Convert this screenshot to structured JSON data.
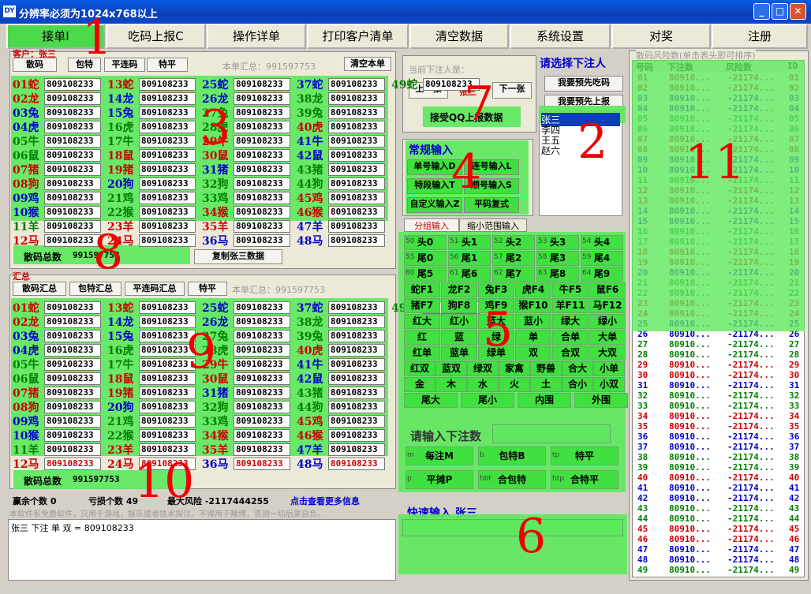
{
  "window": {
    "title": "分辨率必须为1024x768以上",
    "icon": "DY"
  },
  "menu": [
    "接单I",
    "吃码上报C",
    "操作详单",
    "打印客户清单",
    "清空数据",
    "系统设置",
    "对奖",
    "注册"
  ],
  "client": {
    "label": "客户：张三",
    "btns": [
      "散码",
      "包特",
      "平连码",
      "特平"
    ],
    "summary": "本单汇总：991597753",
    "clear": "清空本单",
    "total_label": "散码总数",
    "total_value": "991597753",
    "copy": "复制张三数据"
  },
  "cells": [
    {
      "n": "01",
      "a": "蛇",
      "v": "809108233"
    },
    {
      "n": "02",
      "a": "龙",
      "v": "809108233"
    },
    {
      "n": "03",
      "a": "兔",
      "v": "809108233"
    },
    {
      "n": "04",
      "a": "虎",
      "v": "809108233"
    },
    {
      "n": "05",
      "a": "牛",
      "v": "809108233"
    },
    {
      "n": "06",
      "a": "鼠",
      "v": "809108233"
    },
    {
      "n": "07",
      "a": "猪",
      "v": "809108233"
    },
    {
      "n": "08",
      "a": "狗",
      "v": "809108233"
    },
    {
      "n": "09",
      "a": "鸡",
      "v": "809108233"
    },
    {
      "n": "10",
      "a": "猴",
      "v": "809108233"
    },
    {
      "n": "11",
      "a": "羊",
      "v": "809108233"
    },
    {
      "n": "12",
      "a": "马",
      "v": "809108233"
    },
    {
      "n": "13",
      "a": "蛇",
      "v": "809108233"
    },
    {
      "n": "14",
      "a": "龙",
      "v": "809108233"
    },
    {
      "n": "15",
      "a": "兔",
      "v": "809108233"
    },
    {
      "n": "16",
      "a": "虎",
      "v": "809108233"
    },
    {
      "n": "17",
      "a": "牛",
      "v": "809108233"
    },
    {
      "n": "18",
      "a": "鼠",
      "v": "809108233"
    },
    {
      "n": "19",
      "a": "猪",
      "v": "809108233"
    },
    {
      "n": "20",
      "a": "狗",
      "v": "809108233"
    },
    {
      "n": "21",
      "a": "鸡",
      "v": "809108233"
    },
    {
      "n": "22",
      "a": "猴",
      "v": "809108233"
    },
    {
      "n": "23",
      "a": "羊",
      "v": "809108233"
    },
    {
      "n": "24",
      "a": "马",
      "v": "809108233"
    },
    {
      "n": "25",
      "a": "蛇",
      "v": "809108233"
    },
    {
      "n": "26",
      "a": "龙",
      "v": "809108233"
    },
    {
      "n": "27",
      "a": "兔",
      "v": "809108233"
    },
    {
      "n": "28",
      "a": "虎",
      "v": "809108233"
    },
    {
      "n": "29",
      "a": "牛",
      "v": "809108233"
    },
    {
      "n": "30",
      "a": "鼠",
      "v": "809108233"
    },
    {
      "n": "31",
      "a": "猪",
      "v": "809108233"
    },
    {
      "n": "32",
      "a": "狗",
      "v": "809108233"
    },
    {
      "n": "33",
      "a": "鸡",
      "v": "809108233"
    },
    {
      "n": "34",
      "a": "猴",
      "v": "809108233"
    },
    {
      "n": "35",
      "a": "羊",
      "v": "809108233"
    },
    {
      "n": "36",
      "a": "马",
      "v": "809108233"
    },
    {
      "n": "37",
      "a": "蛇",
      "v": "809108233"
    },
    {
      "n": "38",
      "a": "龙",
      "v": "809108233"
    },
    {
      "n": "39",
      "a": "兔",
      "v": "809108233"
    },
    {
      "n": "40",
      "a": "虎",
      "v": "809108233"
    },
    {
      "n": "41",
      "a": "牛",
      "v": "809108233"
    },
    {
      "n": "42",
      "a": "鼠",
      "v": "809108233"
    },
    {
      "n": "43",
      "a": "猪",
      "v": "809108233"
    },
    {
      "n": "44",
      "a": "狗",
      "v": "809108233"
    },
    {
      "n": "45",
      "a": "鸡",
      "v": "809108233"
    },
    {
      "n": "46",
      "a": "猴",
      "v": "809108233"
    },
    {
      "n": "47",
      "a": "羊",
      "v": "809108233"
    },
    {
      "n": "48",
      "a": "马",
      "v": "809108233"
    },
    {
      "n": "49",
      "a": "蛇",
      "v": "809108233"
    }
  ],
  "summary_panel": {
    "label": "汇总",
    "btns": [
      "散码汇总",
      "包特汇总",
      "平连码汇总",
      "特平"
    ],
    "summary": "本单汇总：991597753",
    "total_label": "散码总数",
    "total_value": "991597753"
  },
  "status": {
    "win": "赢余个数 0",
    "loss": "亏损个数 49",
    "risk": "最大风险 -2117444255",
    "more": "点击查看更多信息"
  },
  "notice": "本软件系免费软件，只用于游戏，娱乐或者技术探讨。不得用于赌博，否则一切后果自负。",
  "log": "张三 下注 单 双 = 809108233",
  "middle": {
    "current_label": "当前下注人是：",
    "prev": "上一张",
    "current_name": "张三",
    "next": "下一张",
    "qq": "接受QQ上报数据",
    "regular": "常规输入",
    "inputs": [
      "单号输入D",
      "连号输入L",
      "特段输入T",
      "顺号输入S",
      "自定义输入Z",
      "平码复式"
    ],
    "tabs": [
      "分组输入",
      "缩小范围输入"
    ],
    "amount_label": "请输入下注数",
    "bet_btns": [
      "每注M",
      "包特B",
      "特平",
      "平摊P",
      "合包特",
      "合特平"
    ],
    "bet_prefix": [
      "m",
      "b",
      "tp",
      "p",
      "hbt",
      "htp"
    ],
    "quick": "快速输入 张三"
  },
  "select": {
    "title": "请选择下注人",
    "btn1": "我要预先吃码",
    "btn2": "我要预先上报",
    "people": [
      "张三",
      "李四",
      "王五",
      "赵六"
    ]
  },
  "grid": [
    [
      "头0",
      "头1",
      "头2",
      "头3",
      "头4"
    ],
    [
      "尾0",
      "尾1",
      "尾2",
      "尾3",
      "尾4"
    ],
    [
      "尾5",
      "尾6",
      "尾7",
      "尾8",
      "尾9"
    ],
    [
      "蛇F1",
      "龙F2",
      "兔F3",
      "虎F4",
      "牛F5",
      "鼠F6"
    ],
    [
      "猪F7",
      "狗F8",
      "鸡F9",
      "猴F10",
      "羊F11",
      "马F12"
    ],
    [
      "红大",
      "红小",
      "蓝大",
      "蓝小",
      "绿大",
      "绿小"
    ],
    [
      "红",
      "蓝",
      "绿",
      "单",
      "合单",
      "大单"
    ],
    [
      "红单",
      "蓝单",
      "绿单",
      "双",
      "合双",
      "大双"
    ],
    [
      "红双",
      "蓝双",
      "绿双",
      "家禽",
      "野兽",
      "合大",
      "小单"
    ],
    [
      "金",
      "木",
      "水",
      "火",
      "土",
      "合小",
      "小双"
    ],
    [
      "尾大",
      "尾小",
      "内围",
      "外围"
    ]
  ],
  "grid_nums": [
    [
      "50",
      "51",
      "52",
      "53",
      "54"
    ],
    [
      "55",
      "56",
      "57",
      "58",
      "59"
    ],
    [
      "60",
      "61",
      "62",
      "63",
      "64"
    ]
  ],
  "risk": {
    "title": "散码风险数(单击表头即可排序)",
    "headers": [
      "号码",
      "下注数",
      "风险数",
      "ID"
    ],
    "bet": "80910...",
    "risk": "-21174..."
  },
  "markers": [
    "1",
    "2",
    "3",
    "4",
    "5",
    "6",
    "7",
    "8",
    "9",
    "10",
    "11"
  ],
  "colors": {
    "red": "#cc0000",
    "green": "#008000",
    "blue": "#0000cc",
    "orange": "#c07000"
  }
}
